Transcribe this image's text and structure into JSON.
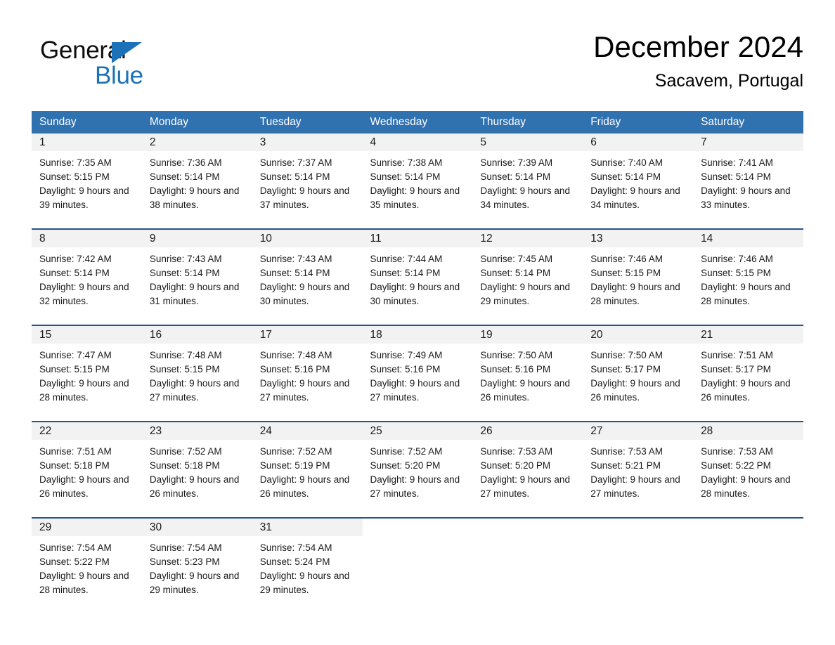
{
  "logo": {
    "word_one": "General",
    "word_two": "Blue",
    "triangle_color": "#1b72b8",
    "text_color": "#0f0f0f"
  },
  "header": {
    "title": "December 2024",
    "location": "Sacavem, Portugal"
  },
  "theme": {
    "header_bar": "#3071b0",
    "row_divider": "#20568f",
    "daynum_band": "#f2f2f2",
    "page_background": "#ffffff",
    "text": "#1a1a1a"
  },
  "day_headers": [
    "Sunday",
    "Monday",
    "Tuesday",
    "Wednesday",
    "Thursday",
    "Friday",
    "Saturday"
  ],
  "weeks": [
    [
      {
        "day": "1",
        "sunrise": "Sunrise: 7:35 AM",
        "sunset": "Sunset: 5:15 PM",
        "daylight": "Daylight: 9 hours and 39 minutes."
      },
      {
        "day": "2",
        "sunrise": "Sunrise: 7:36 AM",
        "sunset": "Sunset: 5:14 PM",
        "daylight": "Daylight: 9 hours and 38 minutes."
      },
      {
        "day": "3",
        "sunrise": "Sunrise: 7:37 AM",
        "sunset": "Sunset: 5:14 PM",
        "daylight": "Daylight: 9 hours and 37 minutes."
      },
      {
        "day": "4",
        "sunrise": "Sunrise: 7:38 AM",
        "sunset": "Sunset: 5:14 PM",
        "daylight": "Daylight: 9 hours and 35 minutes."
      },
      {
        "day": "5",
        "sunrise": "Sunrise: 7:39 AM",
        "sunset": "Sunset: 5:14 PM",
        "daylight": "Daylight: 9 hours and 34 minutes."
      },
      {
        "day": "6",
        "sunrise": "Sunrise: 7:40 AM",
        "sunset": "Sunset: 5:14 PM",
        "daylight": "Daylight: 9 hours and 34 minutes."
      },
      {
        "day": "7",
        "sunrise": "Sunrise: 7:41 AM",
        "sunset": "Sunset: 5:14 PM",
        "daylight": "Daylight: 9 hours and 33 minutes."
      }
    ],
    [
      {
        "day": "8",
        "sunrise": "Sunrise: 7:42 AM",
        "sunset": "Sunset: 5:14 PM",
        "daylight": "Daylight: 9 hours and 32 minutes."
      },
      {
        "day": "9",
        "sunrise": "Sunrise: 7:43 AM",
        "sunset": "Sunset: 5:14 PM",
        "daylight": "Daylight: 9 hours and 31 minutes."
      },
      {
        "day": "10",
        "sunrise": "Sunrise: 7:43 AM",
        "sunset": "Sunset: 5:14 PM",
        "daylight": "Daylight: 9 hours and 30 minutes."
      },
      {
        "day": "11",
        "sunrise": "Sunrise: 7:44 AM",
        "sunset": "Sunset: 5:14 PM",
        "daylight": "Daylight: 9 hours and 30 minutes."
      },
      {
        "day": "12",
        "sunrise": "Sunrise: 7:45 AM",
        "sunset": "Sunset: 5:14 PM",
        "daylight": "Daylight: 9 hours and 29 minutes."
      },
      {
        "day": "13",
        "sunrise": "Sunrise: 7:46 AM",
        "sunset": "Sunset: 5:15 PM",
        "daylight": "Daylight: 9 hours and 28 minutes."
      },
      {
        "day": "14",
        "sunrise": "Sunrise: 7:46 AM",
        "sunset": "Sunset: 5:15 PM",
        "daylight": "Daylight: 9 hours and 28 minutes."
      }
    ],
    [
      {
        "day": "15",
        "sunrise": "Sunrise: 7:47 AM",
        "sunset": "Sunset: 5:15 PM",
        "daylight": "Daylight: 9 hours and 28 minutes."
      },
      {
        "day": "16",
        "sunrise": "Sunrise: 7:48 AM",
        "sunset": "Sunset: 5:15 PM",
        "daylight": "Daylight: 9 hours and 27 minutes."
      },
      {
        "day": "17",
        "sunrise": "Sunrise: 7:48 AM",
        "sunset": "Sunset: 5:16 PM",
        "daylight": "Daylight: 9 hours and 27 minutes."
      },
      {
        "day": "18",
        "sunrise": "Sunrise: 7:49 AM",
        "sunset": "Sunset: 5:16 PM",
        "daylight": "Daylight: 9 hours and 27 minutes."
      },
      {
        "day": "19",
        "sunrise": "Sunrise: 7:50 AM",
        "sunset": "Sunset: 5:16 PM",
        "daylight": "Daylight: 9 hours and 26 minutes."
      },
      {
        "day": "20",
        "sunrise": "Sunrise: 7:50 AM",
        "sunset": "Sunset: 5:17 PM",
        "daylight": "Daylight: 9 hours and 26 minutes."
      },
      {
        "day": "21",
        "sunrise": "Sunrise: 7:51 AM",
        "sunset": "Sunset: 5:17 PM",
        "daylight": "Daylight: 9 hours and 26 minutes."
      }
    ],
    [
      {
        "day": "22",
        "sunrise": "Sunrise: 7:51 AM",
        "sunset": "Sunset: 5:18 PM",
        "daylight": "Daylight: 9 hours and 26 minutes."
      },
      {
        "day": "23",
        "sunrise": "Sunrise: 7:52 AM",
        "sunset": "Sunset: 5:18 PM",
        "daylight": "Daylight: 9 hours and 26 minutes."
      },
      {
        "day": "24",
        "sunrise": "Sunrise: 7:52 AM",
        "sunset": "Sunset: 5:19 PM",
        "daylight": "Daylight: 9 hours and 26 minutes."
      },
      {
        "day": "25",
        "sunrise": "Sunrise: 7:52 AM",
        "sunset": "Sunset: 5:20 PM",
        "daylight": "Daylight: 9 hours and 27 minutes."
      },
      {
        "day": "26",
        "sunrise": "Sunrise: 7:53 AM",
        "sunset": "Sunset: 5:20 PM",
        "daylight": "Daylight: 9 hours and 27 minutes."
      },
      {
        "day": "27",
        "sunrise": "Sunrise: 7:53 AM",
        "sunset": "Sunset: 5:21 PM",
        "daylight": "Daylight: 9 hours and 27 minutes."
      },
      {
        "day": "28",
        "sunrise": "Sunrise: 7:53 AM",
        "sunset": "Sunset: 5:22 PM",
        "daylight": "Daylight: 9 hours and 28 minutes."
      }
    ],
    [
      {
        "day": "29",
        "sunrise": "Sunrise: 7:54 AM",
        "sunset": "Sunset: 5:22 PM",
        "daylight": "Daylight: 9 hours and 28 minutes."
      },
      {
        "day": "30",
        "sunrise": "Sunrise: 7:54 AM",
        "sunset": "Sunset: 5:23 PM",
        "daylight": "Daylight: 9 hours and 29 minutes."
      },
      {
        "day": "31",
        "sunrise": "Sunrise: 7:54 AM",
        "sunset": "Sunset: 5:24 PM",
        "daylight": "Daylight: 9 hours and 29 minutes."
      },
      {
        "day": "",
        "sunrise": "",
        "sunset": "",
        "daylight": ""
      },
      {
        "day": "",
        "sunrise": "",
        "sunset": "",
        "daylight": ""
      },
      {
        "day": "",
        "sunrise": "",
        "sunset": "",
        "daylight": ""
      },
      {
        "day": "",
        "sunrise": "",
        "sunset": "",
        "daylight": ""
      }
    ]
  ]
}
